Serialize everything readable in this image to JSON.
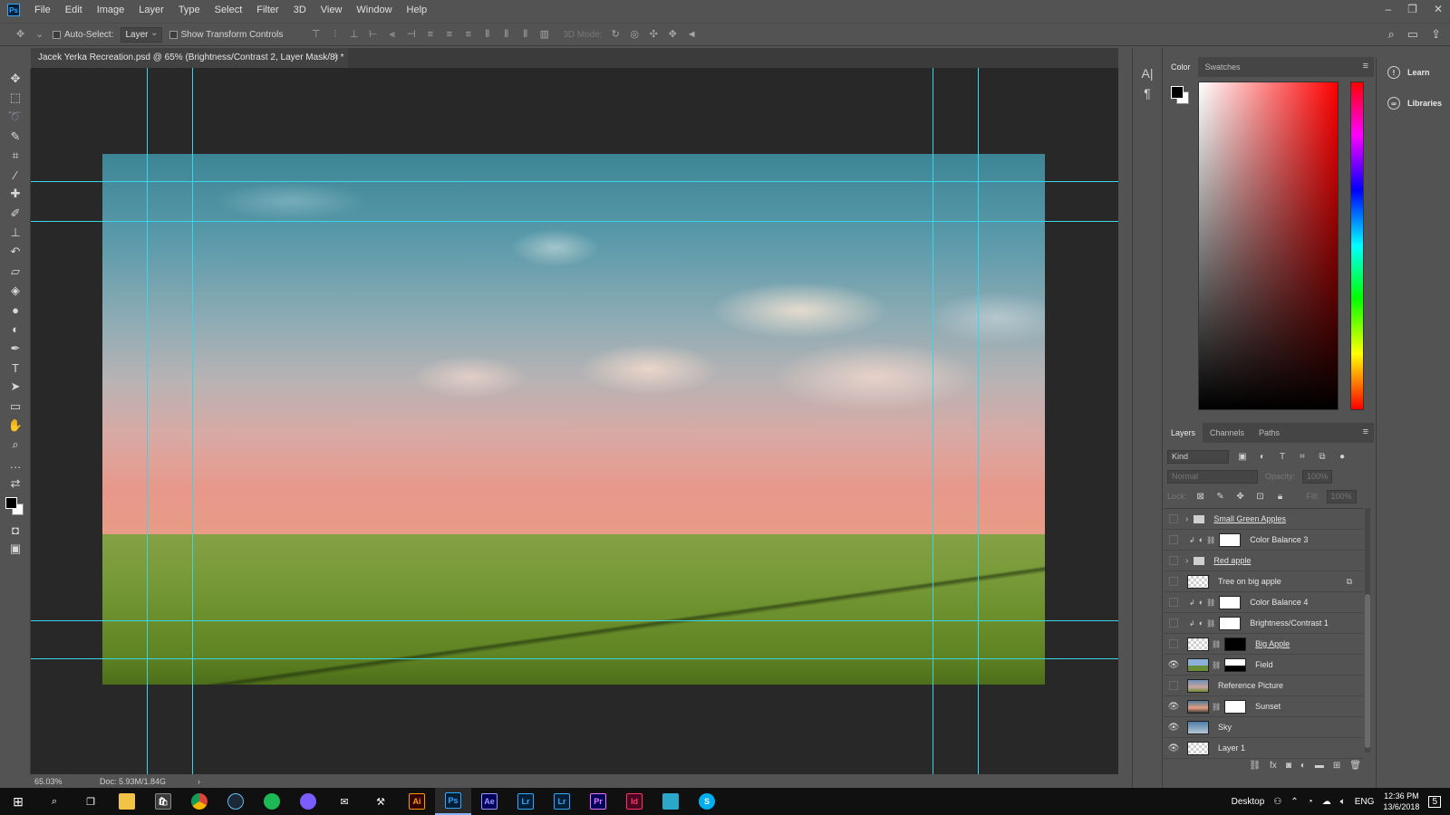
{
  "app": {
    "logo": "Ps"
  },
  "menu": [
    "File",
    "Edit",
    "Image",
    "Layer",
    "Type",
    "Select",
    "Filter",
    "3D",
    "View",
    "Window",
    "Help"
  ],
  "window_controls": {
    "minimize": "–",
    "restore": "❐",
    "close": "✕"
  },
  "options": {
    "auto_select_label": "Auto-Select:",
    "auto_select_value": "Layer",
    "transform_label": "Show Transform Controls",
    "mode3d_label": "3D Mode:"
  },
  "document": {
    "tab_title": "Jacek Yerka Recreation.psd @ 65% (Brightness/Contrast 2, Layer Mask/8) *",
    "zoom": "65.03%",
    "doc_size": "Doc: 5.93M/1.84G"
  },
  "color_panel": {
    "tabs": [
      "Color",
      "Swatches"
    ]
  },
  "right_strip": {
    "learn": "Learn",
    "libraries": "Libraries"
  },
  "layers_panel": {
    "tabs": [
      "Layers",
      "Channels",
      "Paths"
    ],
    "kind_filter": "Kind",
    "blend_mode": "Normal",
    "opacity_label": "Opacity:",
    "opacity_value": "100%",
    "lock_label": "Lock:",
    "fill_label": "Fill:",
    "fill_value": "100%",
    "layers": [
      {
        "name": "Small Green Apples",
        "type": "group",
        "visible": false
      },
      {
        "name": "Color Balance 3",
        "type": "adjustment",
        "visible": false
      },
      {
        "name": "Red apple",
        "type": "group",
        "visible": false
      },
      {
        "name": "Tree on big apple",
        "type": "smart",
        "visible": false
      },
      {
        "name": "Color Balance 4",
        "type": "adjustment",
        "visible": false
      },
      {
        "name": "Brightness/Contrast 1",
        "type": "adjustment",
        "visible": false
      },
      {
        "name": "Big Apple",
        "type": "masked",
        "visible": false
      },
      {
        "name": "Field",
        "type": "masked",
        "visible": true
      },
      {
        "name": "Reference Picture",
        "type": "pixel",
        "visible": false
      },
      {
        "name": "Sunset",
        "type": "masked",
        "visible": true
      },
      {
        "name": "Sky",
        "type": "pixel",
        "visible": true
      },
      {
        "name": "Layer 1",
        "type": "pixel",
        "visible": true
      }
    ]
  },
  "taskbar": {
    "tray_desktop": "Desktop",
    "language": "ENG",
    "time": "12:36 PM",
    "date": "13/6/2018",
    "notifications": "5",
    "apps": [
      "Ai",
      "Ps",
      "Ae",
      "Lr",
      "Lr",
      "Pr",
      "Id"
    ]
  },
  "colors": {
    "guide": "#3ad6e8",
    "accent": "#31a8ff"
  }
}
